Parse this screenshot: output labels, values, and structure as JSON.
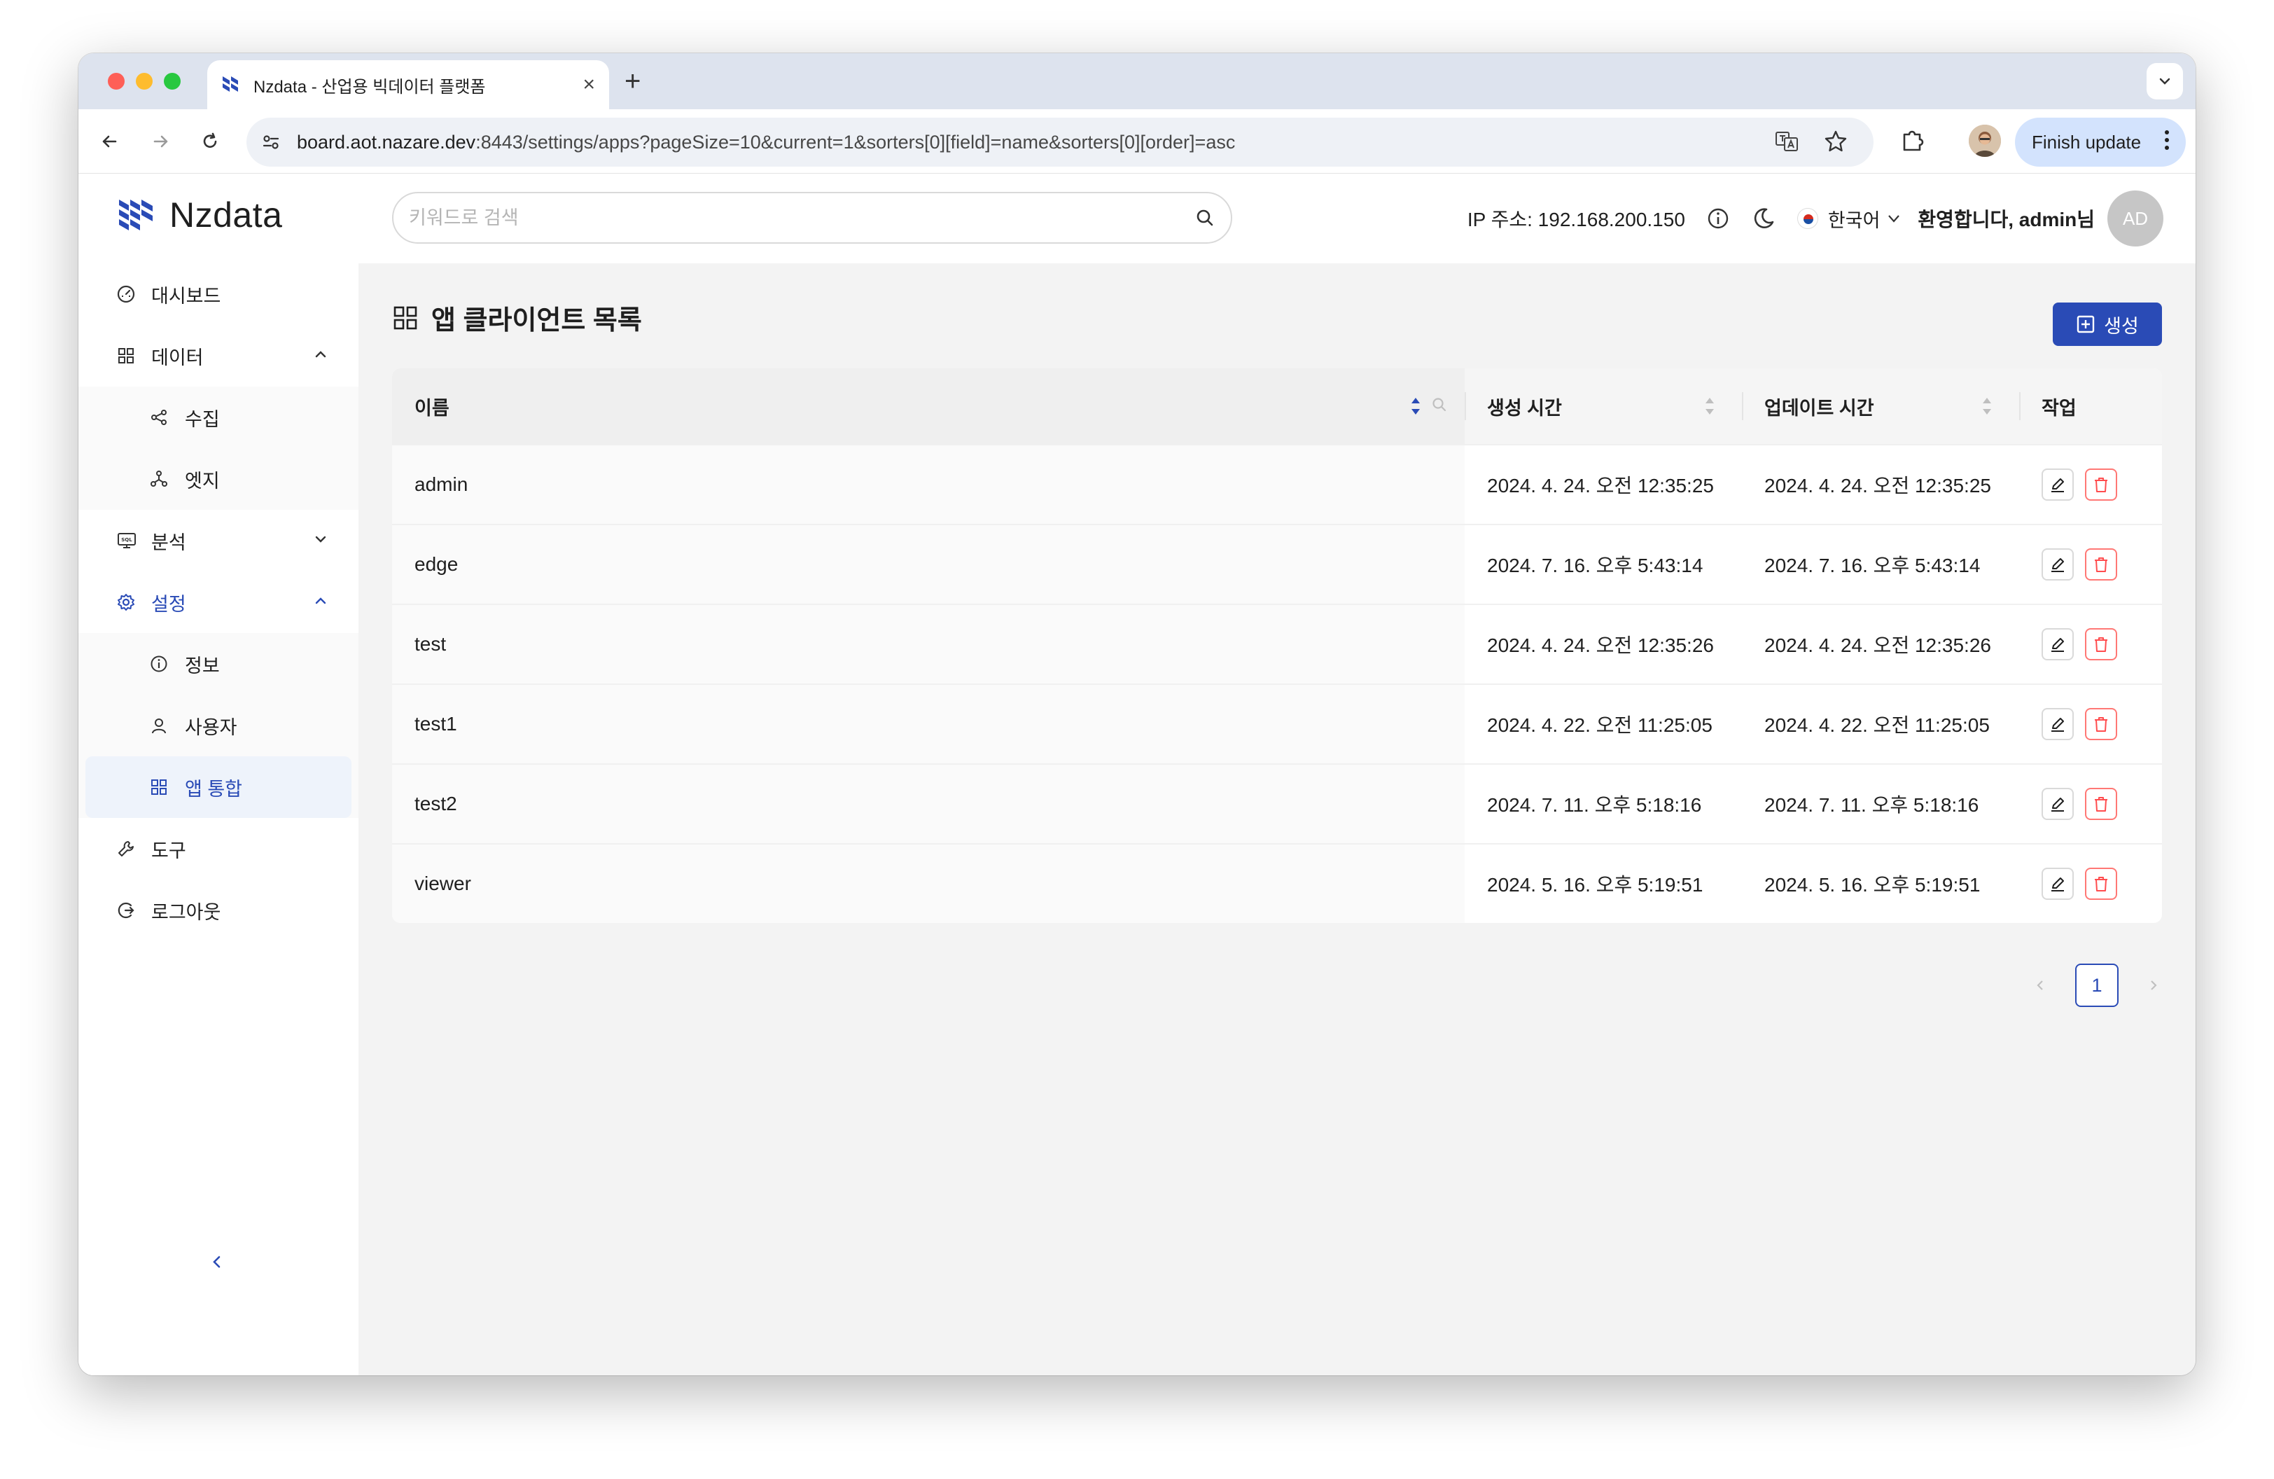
{
  "browser": {
    "tab_title": "Nzdata - 산업용 빅데이터 플랫폼",
    "url_host": "board.aot.nazare.dev",
    "url_rest": ":8443/settings/apps?pageSize=10&current=1&sorters[0][field]=name&sorters[0][order]=asc",
    "finish_update_label": "Finish update"
  },
  "brand": {
    "name": "Nzdata",
    "color": "#2a4bb6"
  },
  "header": {
    "search_placeholder": "키워드로 검색",
    "ip_label": "IP 주소: 192.168.200.150",
    "language": "한국어",
    "welcome": "환영합니다, admin님",
    "avatar_initials": "AD"
  },
  "sidebar": {
    "dashboard": "대시보드",
    "data": "데이터",
    "data_children": [
      "수집",
      "엣지"
    ],
    "analysis": "분석",
    "settings": "설정",
    "settings_children": [
      "정보",
      "사용자",
      "앱 통합"
    ],
    "tools": "도구",
    "logout": "로그아웃"
  },
  "page": {
    "title": "앱 클라이언트 목록",
    "create_label": "생성"
  },
  "table": {
    "columns": [
      "이름",
      "생성 시간",
      "업데이트 시간",
      "작업"
    ],
    "rows": [
      {
        "name": "admin",
        "created": "2024. 4. 24. 오전 12:35:25",
        "updated": "2024. 4. 24. 오전 12:35:25"
      },
      {
        "name": "edge",
        "created": "2024. 7. 16. 오후 5:43:14",
        "updated": "2024. 7. 16. 오후 5:43:14"
      },
      {
        "name": "test",
        "created": "2024. 4. 24. 오전 12:35:26",
        "updated": "2024. 4. 24. 오전 12:35:26"
      },
      {
        "name": "test1",
        "created": "2024. 4. 22. 오전 11:25:05",
        "updated": "2024. 4. 22. 오전 11:25:05"
      },
      {
        "name": "test2",
        "created": "2024. 7. 11. 오후 5:18:16",
        "updated": "2024. 7. 11. 오후 5:18:16"
      },
      {
        "name": "viewer",
        "created": "2024. 5. 16. 오후 5:19:51",
        "updated": "2024. 5. 16. 오후 5:19:51"
      }
    ]
  },
  "pagination": {
    "current": "1"
  },
  "colors": {
    "accent": "#2a4bb6",
    "danger": "#ff4d4f",
    "chrome_bg": "#dde3ee"
  }
}
